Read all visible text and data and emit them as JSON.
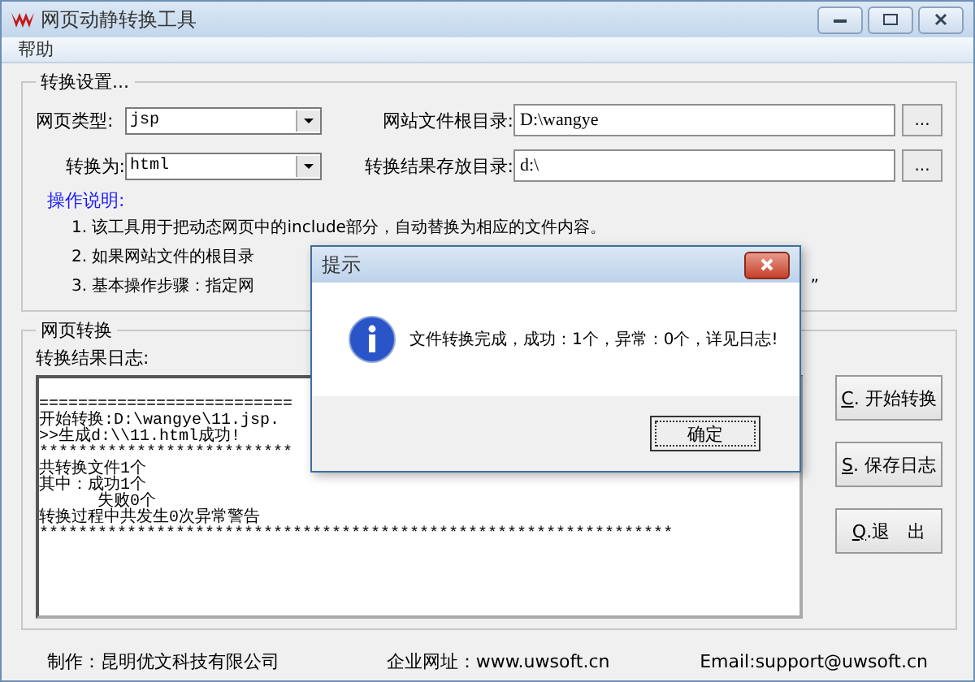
{
  "window": {
    "title": "网页动静转换工具"
  },
  "menu": [
    {
      "label": "帮助"
    }
  ],
  "settings": {
    "title": "转换设置...",
    "page_type": {
      "label": "网页类型:",
      "value": "jsp"
    },
    "convert_to": {
      "label": "转换为:",
      "value": "html"
    },
    "root_dir": {
      "label": "网站文件根目录:",
      "value": "D:\\wangye",
      "browse": "..."
    },
    "output_dir": {
      "label": "转换结果存放目录:",
      "value": "d:\\",
      "browse": "..."
    },
    "instructions_title": "操作说明:",
    "instructions": [
      {
        "text": "1. 该工具用于把动态网页中的include部分，自动替换为相应的文件内容。"
      },
      {
        "text": "2. 如果网站文件的根目录"
      },
      {
        "text": "3. 基本操作步骤：指定网",
        "tail": "”"
      }
    ]
  },
  "conversion": {
    "title": "网页转换",
    "log_label": "转换结果日志:",
    "log": [
      "==========================",
      "开始转换:D:\\wangye\\11.jsp.",
      ">>生成d:\\\\11.html成功!",
      "**************************",
      "共转换文件1个",
      "其中：成功1个",
      "      失败0个",
      "转换过程中共发生0次异常警告",
      "*****************************************************************"
    ],
    "buttons": [
      {
        "hotkey": "C",
        "label": ". 开始转换"
      },
      {
        "hotkey": "S",
        "label": ". 保存日志"
      },
      {
        "hotkey": "Q",
        "label": ".退　出"
      }
    ]
  },
  "footer": [
    "制作：昆明优文科技有限公司",
    "企业网址：www.uwsoft.cn",
    "Email:support@uwsoft.cn"
  ],
  "dialog": {
    "title": "提示",
    "message": "文件转换完成，成功：1个，异常：0个，详见日志!",
    "ok": "确定"
  }
}
